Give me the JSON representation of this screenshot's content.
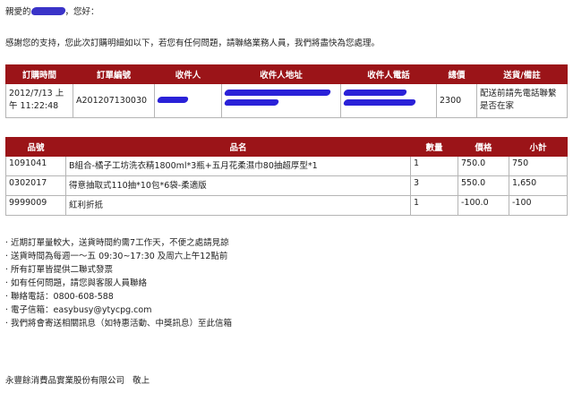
{
  "greeting": {
    "prefix": "親愛的",
    "suffix": "，您好："
  },
  "intro_text": "感謝您的支持，您此次訂購明細如以下，若您有任何問題，請聯絡業務人員，我們將盡快為您處理。",
  "order_table": {
    "headers": [
      "訂購時間",
      "訂單編號",
      "收件人",
      "收件人地址",
      "收件人電話",
      "總價",
      "送貨/備註"
    ],
    "row": {
      "time": "2012/7/13 上午 11:22:48",
      "order_no": "A201207130030",
      "total": "2300",
      "note": "配送前請先電話聯繫是否在家"
    }
  },
  "items_table": {
    "headers": [
      "品號",
      "品名",
      "數量",
      "價格",
      "小計"
    ],
    "rows": [
      {
        "code": "1091041",
        "name": "B組合-橘子工坊洗衣精1800ml*3瓶+五月花柔濕巾80抽超厚型*1",
        "qty": "1",
        "price": "750.0",
        "subtotal": "750"
      },
      {
        "code": "0302017",
        "name": "得意抽取式110抽*10包*6袋-柔適版",
        "qty": "3",
        "price": "550.0",
        "subtotal": "1,650"
      },
      {
        "code": "9999009",
        "name": "紅利折抵",
        "qty": "1",
        "price": "-100.0",
        "subtotal": "-100"
      }
    ]
  },
  "notes": [
    "近期訂單量較大，送貨時間約需7工作天，不便之處請見諒",
    "送貨時間為每週一～五 09:30~17:30 及周六上午12點前",
    "所有訂單皆提供二聯式發票",
    "如有任何問題，請您與客服人員聯絡",
    "聯絡電話：0800-608-588",
    "電子信箱：easybusy@ytycpg.com",
    "我們將會寄送相關訊息（如特惠活動、中獎訊息）至此信箱"
  ],
  "footer": {
    "company": "永豐餘消費品實業股份有限公司",
    "closing": "敬上"
  },
  "colors": {
    "header_bg": "#9b1418",
    "redaction": "#2a21d8"
  }
}
